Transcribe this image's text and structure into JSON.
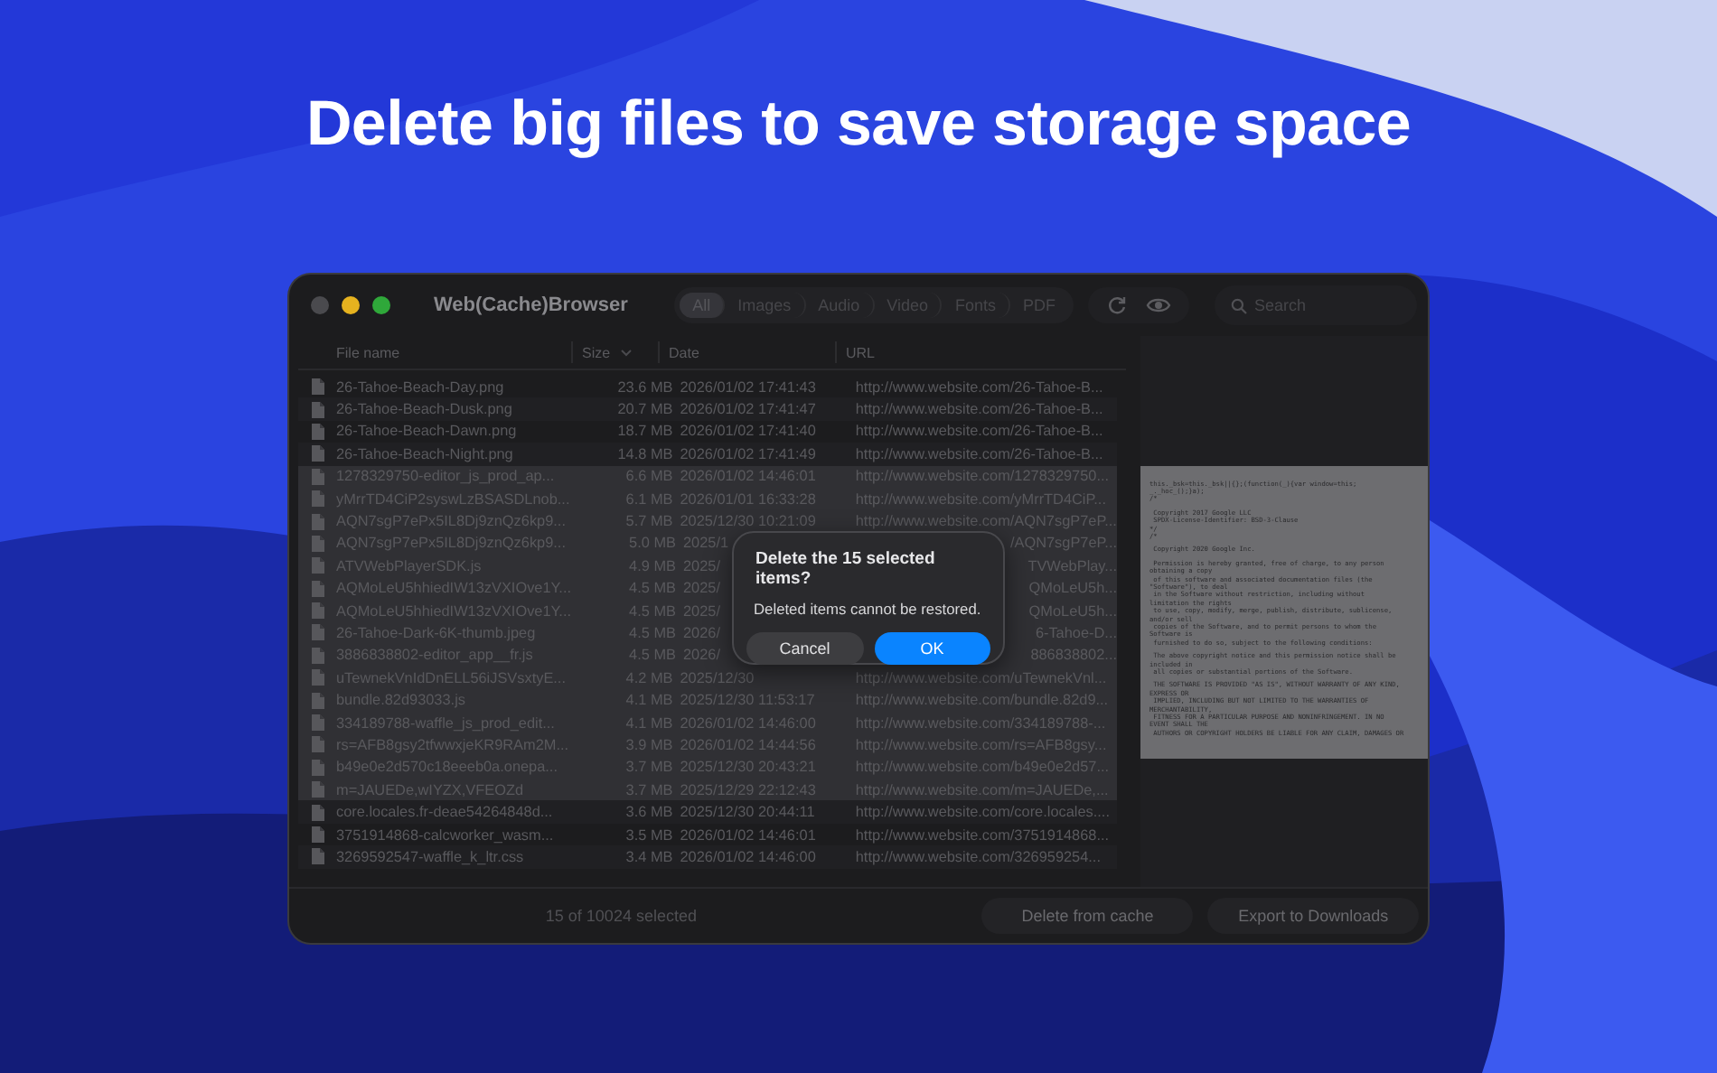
{
  "headline": "Delete big files to save storage space",
  "window": {
    "title": "Web(Cache)Browser"
  },
  "filters": [
    {
      "label": "All",
      "selected": true
    },
    {
      "label": "Images",
      "selected": false
    },
    {
      "label": "Audio",
      "selected": false
    },
    {
      "label": "Video",
      "selected": false
    },
    {
      "label": "Fonts",
      "selected": false
    },
    {
      "label": "PDF",
      "selected": false
    }
  ],
  "search": {
    "placeholder": "Search"
  },
  "table": {
    "columns": [
      "File name",
      "Size",
      "Date",
      "URL"
    ],
    "rows": [
      {
        "name": "26-Tahoe-Beach-Day.png",
        "size": "23.6 MB",
        "date": "2026/01/02 17:41:43",
        "url": "http://www.website.com/26-Tahoe-B...",
        "selected": false,
        "covered": false
      },
      {
        "name": "26-Tahoe-Beach-Dusk.png",
        "size": "20.7 MB",
        "date": "2026/01/02 17:41:47",
        "url": "http://www.website.com/26-Tahoe-B...",
        "selected": false,
        "covered": false
      },
      {
        "name": "26-Tahoe-Beach-Dawn.png",
        "size": "18.7 MB",
        "date": "2026/01/02 17:41:40",
        "url": "http://www.website.com/26-Tahoe-B...",
        "selected": false,
        "covered": false
      },
      {
        "name": "26-Tahoe-Beach-Night.png",
        "size": "14.8 MB",
        "date": "2026/01/02 17:41:49",
        "url": "http://www.website.com/26-Tahoe-B...",
        "selected": false,
        "covered": false
      },
      {
        "name": "1278329750-editor_js_prod_ap...",
        "size": "6.6 MB",
        "date": "2026/01/02 14:46:01",
        "url": "http://www.website.com/1278329750...",
        "selected": true,
        "covered": false
      },
      {
        "name": "yMrrTD4CiP2syswLzBSASDLnob...",
        "size": "6.1 MB",
        "date": "2026/01/01 16:33:28",
        "url": "http://www.website.com/yMrrTD4CiP...",
        "selected": true,
        "covered": false
      },
      {
        "name": "AQN7sgP7ePx5IL8Dj9znQz6kp9...",
        "size": "5.7 MB",
        "date": "2025/12/30 10:21:09",
        "url": "http://www.website.com/AQN7sgP7eP...",
        "selected": true,
        "covered": false
      },
      {
        "name": "AQN7sgP7ePx5IL8Dj9znQz6kp9...",
        "size": "5.0 MB",
        "date": "2025/1",
        "url": "/AQN7sgP7eP...",
        "selected": true,
        "covered": true
      },
      {
        "name": "ATVWebPlayerSDK.js",
        "size": "4.9 MB",
        "date": "2025/",
        "url": "TVWebPlay...",
        "selected": true,
        "covered": true
      },
      {
        "name": "AQMoLeU5hhiedIW13zVXIOve1Y...",
        "size": "4.5 MB",
        "date": "2025/",
        "url": "QMoLeU5h...",
        "selected": true,
        "covered": true
      },
      {
        "name": "AQMoLeU5hhiedIW13zVXIOve1Y...",
        "size": "4.5 MB",
        "date": "2025/",
        "url": "QMoLeU5h...",
        "selected": true,
        "covered": true
      },
      {
        "name": "26-Tahoe-Dark-6K-thumb.jpeg",
        "size": "4.5 MB",
        "date": "2026/",
        "url": "6-Tahoe-D...",
        "selected": true,
        "covered": true
      },
      {
        "name": "3886838802-editor_app__fr.js",
        "size": "4.5 MB",
        "date": "2026/",
        "url": "886838802...",
        "selected": true,
        "covered": true
      },
      {
        "name": "uTewnekVnIdDnELL56iJSVsxtyE...",
        "size": "4.2 MB",
        "date": "2025/12/30",
        "url": "http://www.website.com/uTewnekVnl...",
        "selected": true,
        "covered": false
      },
      {
        "name": "bundle.82d93033.js",
        "size": "4.1 MB",
        "date": "2025/12/30 11:53:17",
        "url": "http://www.website.com/bundle.82d9...",
        "selected": true,
        "covered": false
      },
      {
        "name": "334189788-waffle_js_prod_edit...",
        "size": "4.1 MB",
        "date": "2026/01/02 14:46:00",
        "url": "http://www.website.com/334189788-...",
        "selected": true,
        "covered": false
      },
      {
        "name": "rs=AFB8gsy2tfwwxjeKR9RAm2M...",
        "size": "3.9 MB",
        "date": "2026/01/02 14:44:56",
        "url": "http://www.website.com/rs=AFB8gsy...",
        "selected": true,
        "covered": false
      },
      {
        "name": "b49e0e2d570c18eeeb0a.onepa...",
        "size": "3.7 MB",
        "date": "2025/12/30 20:43:21",
        "url": "http://www.website.com/b49e0e2d57...",
        "selected": true,
        "covered": false
      },
      {
        "name": "m=JAUEDe,wIYZX,VFEOZd",
        "size": "3.7 MB",
        "date": "2025/12/29 22:12:43",
        "url": "http://www.website.com/m=JAUEDe,...",
        "selected": true,
        "covered": false
      },
      {
        "name": "core.locales.fr-deae54264848d...",
        "size": "3.6 MB",
        "date": "2025/12/30 20:44:11",
        "url": "http://www.website.com/core.locales....",
        "selected": false,
        "covered": false
      },
      {
        "name": "3751914868-calcworker_wasm...",
        "size": "3.5 MB",
        "date": "2026/01/02 14:46:01",
        "url": "http://www.website.com/3751914868...",
        "selected": false,
        "covered": false
      },
      {
        "name": "3269592547-waffle_k_ltr.css",
        "size": "3.4 MB",
        "date": "2026/01/02 14:46:00",
        "url": "http://www.website.com/326959254...",
        "selected": false,
        "covered": false
      }
    ]
  },
  "preview": {
    "blocks": [
      [
        "this._bsk=this._bsk||{};(function(_){var window=this;",
        "_._hoc_();}a);",
        "/*"
      ],
      [
        " Copyright 2017 Google LLC",
        " SPDX-License-Identifier: BSD-3-Clause",
        "*/",
        "/*"
      ],
      [
        " Copyright 2020 Google Inc."
      ],
      [
        " Permission is hereby granted, free of charge, to any person",
        "obtaining a copy",
        " of this software and associated documentation files (the",
        "\"Software\"), to deal",
        " in the Software without restriction, including without",
        "limitation the rights",
        " to use, copy, modify, merge, publish, distribute, sublicense,",
        "and/or sell",
        " copies of the Software, and to permit persons to whom the",
        "Software is",
        " furnished to do so, subject to the following conditions:"
      ],
      [
        " The above copyright notice and this permission notice shall be",
        "included in",
        " all copies or substantial portions of the Software."
      ],
      [
        " THE SOFTWARE IS PROVIDED \"AS IS\", WITHOUT WARRANTY OF ANY KIND,",
        "EXPRESS OR",
        " IMPLIED, INCLUDING BUT NOT LIMITED TO THE WARRANTIES OF",
        "MERCHANTABILITY,",
        " FITNESS FOR A PARTICULAR PURPOSE AND NONINFRINGEMENT. IN NO",
        "EVENT SHALL THE",
        " AUTHORS OR COPYRIGHT HOLDERS BE LIABLE FOR ANY CLAIM, DAMAGES OR"
      ]
    ]
  },
  "status": "15 of 10024 selected",
  "footer_buttons": [
    "Delete from cache",
    "Export to Downloads"
  ],
  "dialog": {
    "title": "Delete the 15 selected items?",
    "message": "Deleted items cannot be restored.",
    "buttons": [
      {
        "label": "Cancel",
        "kind": "secondary"
      },
      {
        "label": "OK",
        "kind": "primary"
      }
    ]
  }
}
